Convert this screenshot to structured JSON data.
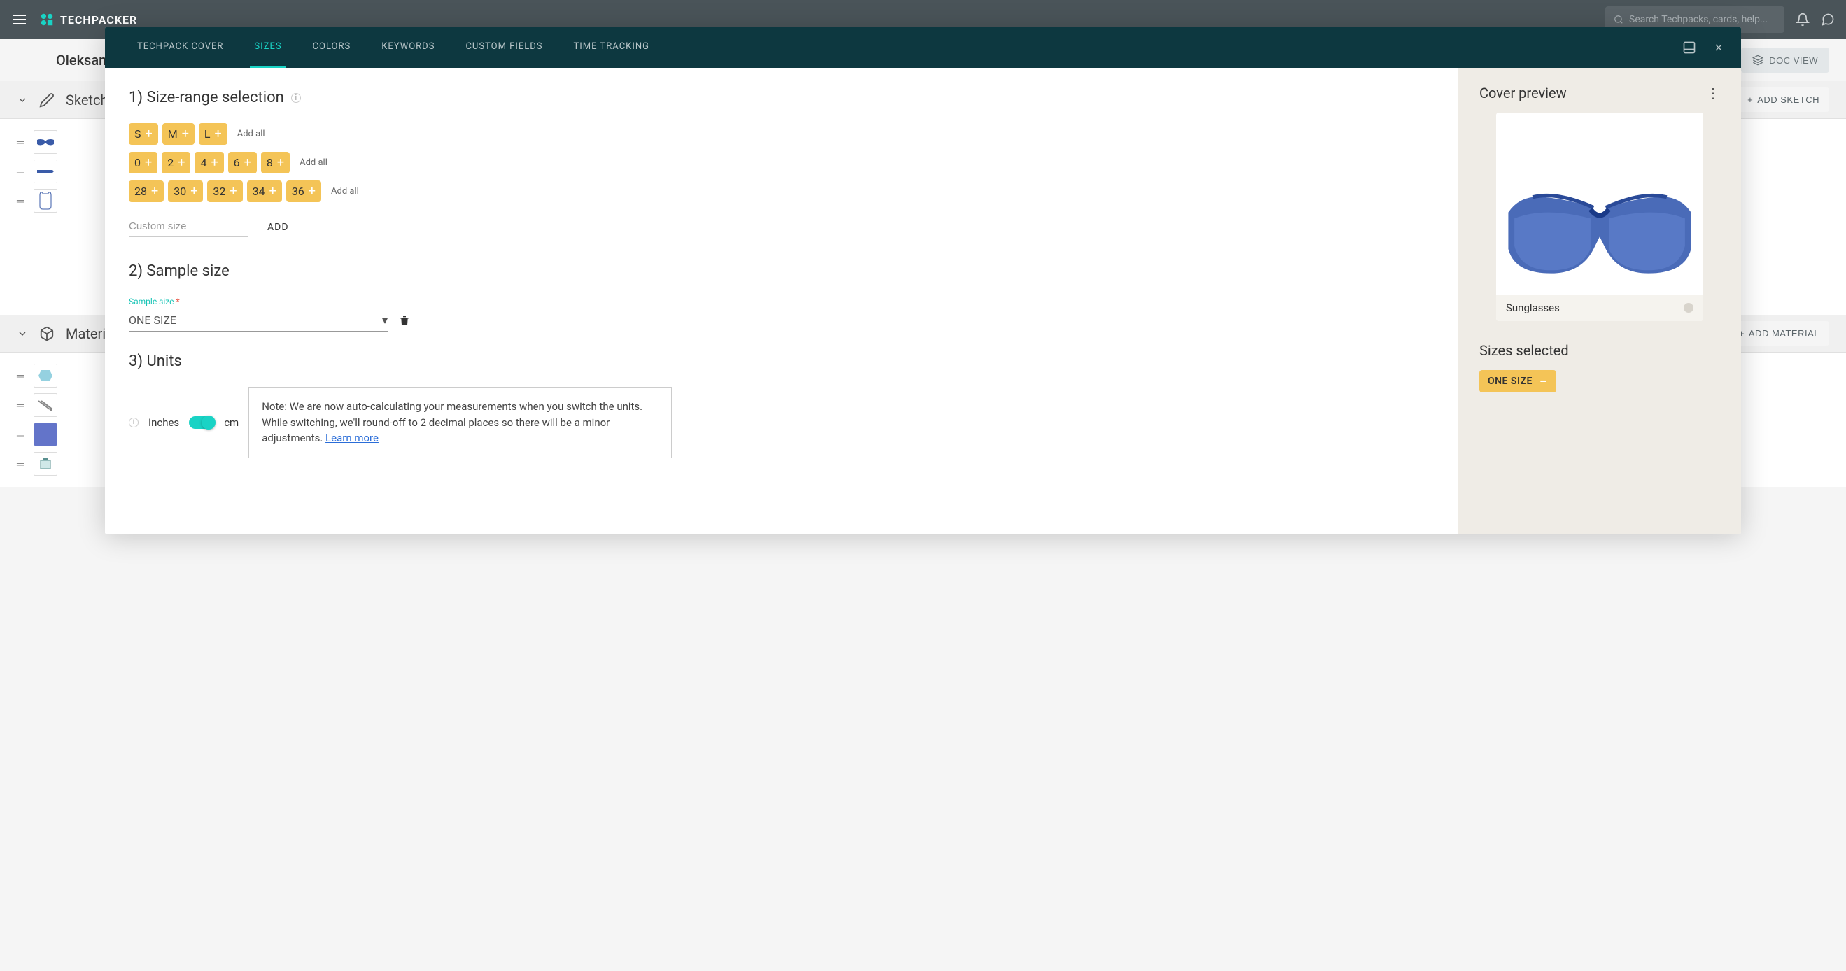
{
  "header": {
    "app_name": "TECHPACKER",
    "search_placeholder": "Search Techpacks, cards, help..."
  },
  "page": {
    "username": "Oleksan",
    "doc_view": "DOC VIEW"
  },
  "sections": {
    "sketch": {
      "title": "Sketch",
      "add": "ADD SKETCH"
    },
    "material": {
      "title": "Materi",
      "add": "ADD MATERIAL"
    }
  },
  "modal": {
    "tabs": [
      "TECHPACK COVER",
      "SIZES",
      "COLORS",
      "KEYWORDS",
      "CUSTOM FIELDS",
      "TIME TRACKING"
    ],
    "active_tab": "SIZES",
    "step1": {
      "title": "1) Size-range selection",
      "rows": [
        {
          "sizes": [
            "S",
            "M",
            "L"
          ],
          "add_all": "Add all"
        },
        {
          "sizes": [
            "0",
            "2",
            "4",
            "6",
            "8"
          ],
          "add_all": "Add all"
        },
        {
          "sizes": [
            "28",
            "30",
            "32",
            "34",
            "36"
          ],
          "add_all": "Add all"
        }
      ],
      "custom_placeholder": "Custom size",
      "add_button": "ADD"
    },
    "step2": {
      "title": "2) Sample size",
      "field_label": "Sample size",
      "value": "ONE SIZE"
    },
    "step3": {
      "title": "3) Units",
      "inches": "Inches",
      "cm": "cm",
      "note": "Note: We are now auto-calculating your measurements when you switch the units. While switching, we'll round-off to 2 decimal places so there will be a minor adjustments. ",
      "learn_more": "Learn more"
    },
    "preview": {
      "title": "Cover preview",
      "card_name": "Sunglasses",
      "sizes_selected": "Sizes selected",
      "selected_size": "ONE SIZE"
    }
  }
}
